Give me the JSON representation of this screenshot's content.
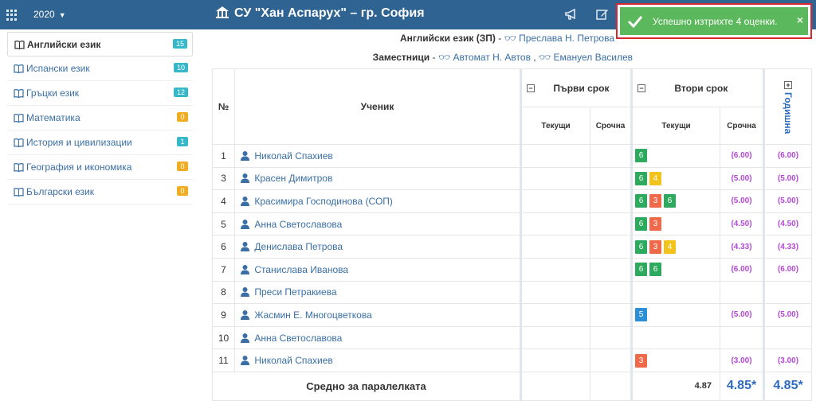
{
  "header": {
    "year": "2020",
    "school": "СУ \"Хан Аспарух\" – гр. София"
  },
  "toast": {
    "message": "Успешно изтрихте 4 оценки.",
    "close": "×"
  },
  "sidebar": {
    "items": [
      {
        "label": "Английски език",
        "count": "15",
        "color": "teal",
        "active": true
      },
      {
        "label": "Испански език",
        "count": "10",
        "color": "teal",
        "active": false
      },
      {
        "label": "Гръцки език",
        "count": "12",
        "color": "teal",
        "active": false
      },
      {
        "label": "Математика",
        "count": "0",
        "color": "yellow",
        "active": false
      },
      {
        "label": "История и цивилизации",
        "count": "1",
        "color": "teal",
        "active": false
      },
      {
        "label": "География и икономика",
        "count": "0",
        "color": "yellow",
        "active": false
      },
      {
        "label": "Български език",
        "count": "0",
        "color": "yellow",
        "active": false
      }
    ]
  },
  "subject": {
    "title": "Английски език (ЗП)",
    "teacher": "Преслава Н. Петрова",
    "substitutes_label": "Заместници",
    "substitute1": "Автомат Н. Автов",
    "substitute2": "Емануел Василев"
  },
  "table": {
    "headers": {
      "num": "№",
      "student": "Ученик",
      "term1": "Първи срок",
      "term2": "Втори срок",
      "annual": "Годишна",
      "current": "Текущи",
      "term_grade": "Срочна",
      "collapse": "−",
      "expand": "+"
    },
    "rows": [
      {
        "num": "1",
        "name": "Николай Спахиев",
        "grades": [
          "6"
        ],
        "term2_avg": "(6.00)",
        "annual": "(6.00)"
      },
      {
        "num": "3",
        "name": "Красен Димитров",
        "grades": [
          "6",
          "4"
        ],
        "term2_avg": "(5.00)",
        "annual": "(5.00)"
      },
      {
        "num": "4",
        "name": "Красимира Господинова (СОП)",
        "grades": [
          "6",
          "3",
          "6"
        ],
        "term2_avg": "(5.00)",
        "annual": "(5.00)"
      },
      {
        "num": "5",
        "name": "Анна Светославова",
        "grades": [
          "6",
          "3"
        ],
        "term2_avg": "(4.50)",
        "annual": "(4.50)"
      },
      {
        "num": "6",
        "name": "Денислава Петрова",
        "grades": [
          "6",
          "3",
          "4"
        ],
        "term2_avg": "(4.33)",
        "annual": "(4.33)"
      },
      {
        "num": "7",
        "name": "Станислава Иванова",
        "grades": [
          "6",
          "6"
        ],
        "term2_avg": "(6.00)",
        "annual": "(6.00)"
      },
      {
        "num": "8",
        "name": "Преси Петракиева",
        "grades": [],
        "term2_avg": "",
        "annual": ""
      },
      {
        "num": "9",
        "name": "Жасмин Е. Многоцветкова",
        "grades": [
          "5"
        ],
        "term2_avg": "(5.00)",
        "annual": "(5.00)"
      },
      {
        "num": "10",
        "name": "Анна Светославова",
        "grades": [],
        "term2_avg": "",
        "annual": ""
      },
      {
        "num": "11",
        "name": "Николай Спахиев",
        "grades": [
          "3"
        ],
        "term2_avg": "(3.00)",
        "annual": "(3.00)"
      }
    ],
    "footer": {
      "label": "Средно за паралелката",
      "current_avg": "4.87",
      "term_avg": "4.85*",
      "annual_avg": "4.85*"
    }
  }
}
